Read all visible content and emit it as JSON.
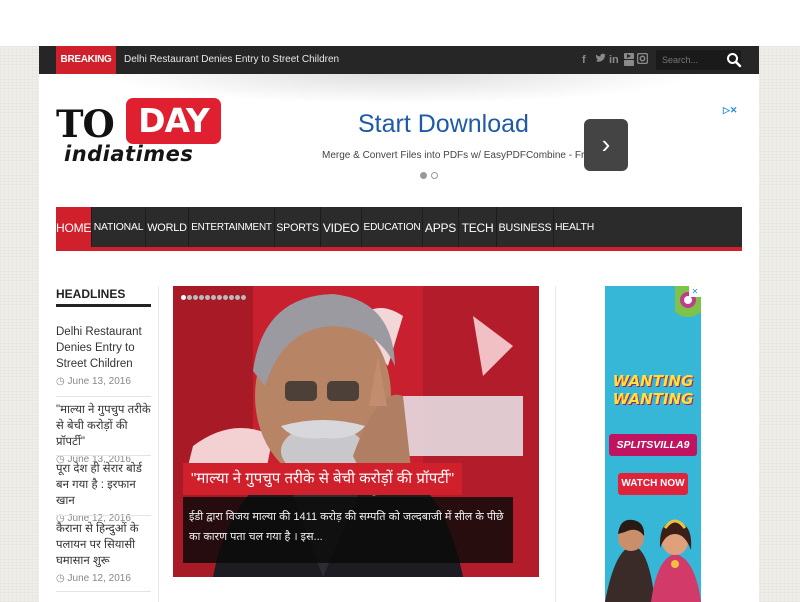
{
  "topbar": {
    "breaking_label": "BREAKING NEWS",
    "breaking_headline": "Delhi Restaurant Denies Entry to Street Children",
    "social_icons": [
      "facebook-icon",
      "twitter-icon",
      "linkedin-icon",
      "youtube-icon",
      "instagram-icon"
    ],
    "search_placeholder": "Search..."
  },
  "logo": {
    "part1": "TO",
    "part2": "DAY",
    "part3": "indiatimes"
  },
  "ad": {
    "title": "Start Download",
    "subtitle": "Merge & Convert Files into PDFs w/ EasyPDFCombine - Free!",
    "arrow": "›",
    "choices_label": "▷✕"
  },
  "nav": {
    "items": [
      {
        "label": "HOME",
        "active": true
      },
      {
        "label": "NATIONAL"
      },
      {
        "label": "WORLD"
      },
      {
        "label": "ENTERTAINMENT ▾"
      },
      {
        "label": "SPORTS"
      },
      {
        "label": "VIDEO"
      },
      {
        "label": "EDUCATION"
      },
      {
        "label": "APPS"
      },
      {
        "label": "TECH"
      },
      {
        "label": "BUSINESS"
      },
      {
        "label": "HEALTH"
      }
    ]
  },
  "headlines": {
    "title": "HEADLINES",
    "items": [
      {
        "title": "Delhi Restaurant Denies Entry to Street Children",
        "date": "◷ June 13, 2016"
      },
      {
        "title": "\"माल्या ने गुपचुप तरीके से बेची करोड़ों की प्रॉपर्टी\"",
        "date": "◷ June 13, 2016"
      },
      {
        "title": "पूरा देश ही सेरार बोर्ड बन गया है : इरफान खान",
        "date": "◷ June 12, 2016"
      },
      {
        "title": "कैराना से हिन्दुओं के पलायन पर सियासी घमासान शुरू",
        "date": "◷ June 12, 2016"
      }
    ]
  },
  "slider": {
    "title": "\"माल्या ने गुपचुप तरीके से बेची करोड़ों की प्रॉपर्टी\"",
    "excerpt": "ईडी द्वारा विजय माल्या की 1411 करोड़ की सम्पति को जल्दबाजी में सील के पीछे का कारण पता चल गया है । इस...",
    "dot_count": 11
  },
  "right_ad": {
    "wanting": "WANTING WANTING",
    "show": "SPLITSVILLA9",
    "cta": "WATCH NOW",
    "close": "✕"
  },
  "colors": {
    "brand_red": "#d0202c",
    "nav_bg": "#2b2b2b",
    "topbar_bg": "#262626",
    "ad_blue": "#1e5aa8"
  }
}
